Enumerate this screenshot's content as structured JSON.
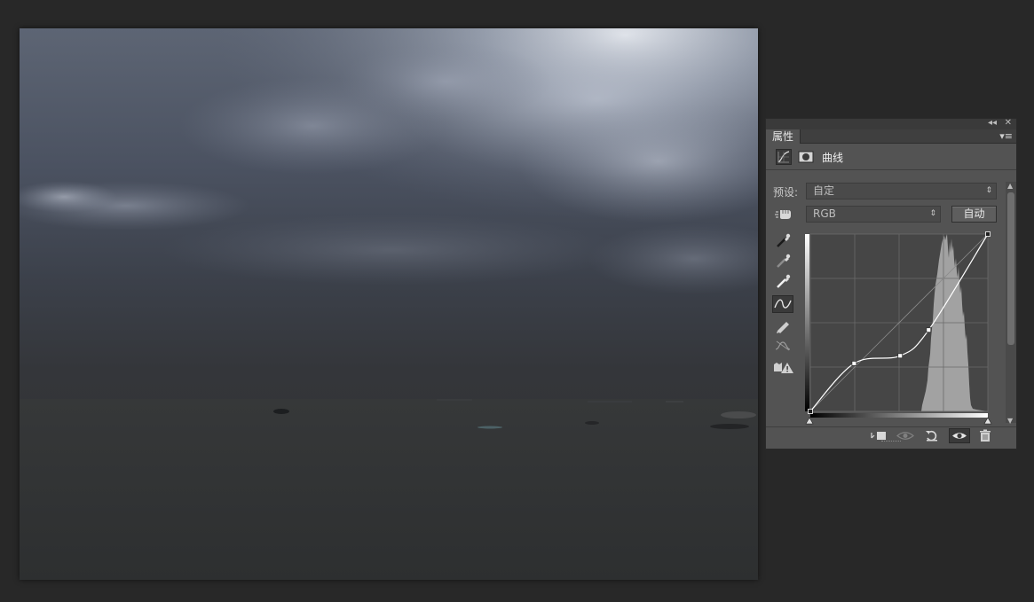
{
  "panel": {
    "collapse_icon": "◂◂",
    "close_icon": "✕",
    "tab_label": "属性",
    "menu_icon": "▾≡",
    "title": "曲线",
    "preset_label": "预设:",
    "preset_value": "自定",
    "channel_value": "RGB",
    "auto_label": "自动",
    "select_arrow": "⇕"
  },
  "curve": {
    "control_points": [
      [
        0,
        0
      ],
      [
        63,
        69
      ],
      [
        129,
        80
      ],
      [
        170,
        117
      ],
      [
        255,
        255
      ]
    ]
  },
  "colors": {
    "panel_bg": "#535353",
    "app_bg": "#282828",
    "curve": "#ffffff",
    "histogram": "#a2a2a2"
  },
  "icons": {
    "tools": [
      "sample-image-icon",
      "black-point-eyedropper-icon",
      "gray-point-eyedropper-icon",
      "white-point-eyedropper-icon",
      "curve-points-icon",
      "pencil-draw-icon",
      "smooth-curve-icon",
      "clipping-warning-icon"
    ],
    "bottom": [
      "clip-to-layer-icon",
      "view-previous-icon",
      "reset-icon",
      "visibility-eye-icon",
      "trash-icon"
    ]
  }
}
